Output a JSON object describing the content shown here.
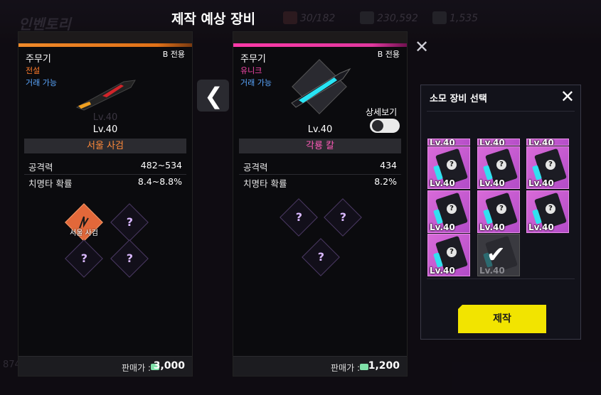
{
  "background": {
    "inventory_title": "인벤토리",
    "stat1": "30/182",
    "stat2": "230,592",
    "stat3": "1,535",
    "left_number": "874"
  },
  "header": {
    "title": "제작 예상 장비"
  },
  "left_card": {
    "slot": "주무기",
    "exclusive": "B 전용",
    "rarity": "전설",
    "rarity_color": "#ff7a2a",
    "tradable": "거래 가능",
    "level": "Lv.40",
    "name": "서울 사검",
    "name_color": "#ff8a3a",
    "stats": [
      {
        "label": "공격력",
        "value": "482~534"
      },
      {
        "label": "치명타 확률",
        "value": "8.4~8.8%"
      }
    ],
    "set_slot_label": "서울 사검",
    "price_label": "판매가 :",
    "price": "3,000"
  },
  "right_card": {
    "slot": "주무기",
    "exclusive": "B 전용",
    "rarity": "유니크",
    "rarity_color": "#ff4ab0",
    "tradable": "거래 가능",
    "level": "Lv.40",
    "name": "각룡 칼",
    "name_color": "#ff5ab8",
    "stats": [
      {
        "label": "공격력",
        "value": "434"
      },
      {
        "label": "치명타 확률",
        "value": "8.2%"
      }
    ],
    "price_label": "판매가 :",
    "price": "1,200"
  },
  "toggle": {
    "label": "상세보기",
    "on": false
  },
  "panel": {
    "title": "소모 장비 선택",
    "item_level": "Lv.40",
    "items_count": 11,
    "selected_index": 10,
    "craft_label": "제작"
  }
}
